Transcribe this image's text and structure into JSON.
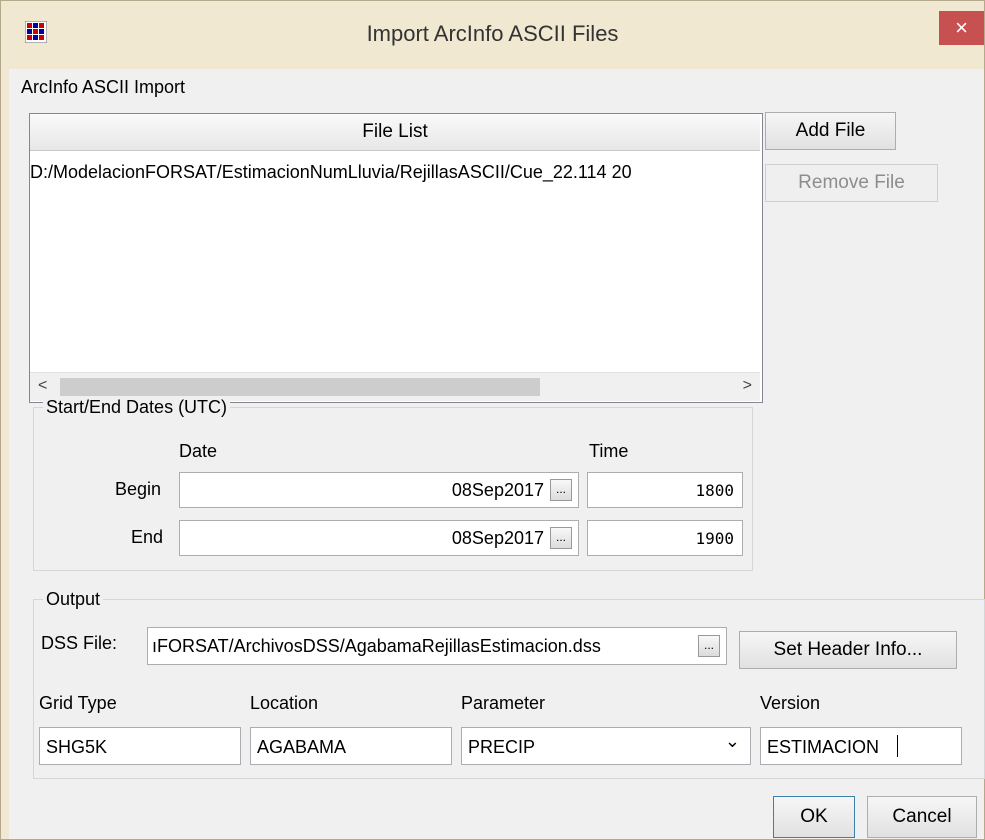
{
  "window": {
    "title": "Import ArcInfo ASCII Files",
    "close_glyph": "×",
    "app_icon": "grid-app-icon"
  },
  "import_section": {
    "label": "ArcInfo ASCII Import",
    "file_list_header": "File List",
    "files": [
      "D:/ModelacionFORSAT/EstimacionNumLluvia/RejillasASCII/Cue_22.114 20"
    ],
    "add_file": "Add File",
    "remove_file": "Remove File",
    "scroll_left": "<",
    "scroll_right": ">"
  },
  "dates": {
    "group_title": "Start/End Dates (UTC)",
    "date_header": "Date",
    "time_header": "Time",
    "begin_label": "Begin",
    "end_label": "End",
    "begin_date": "08Sep2017",
    "begin_time": "1800",
    "end_date": "08Sep2017",
    "end_time": "1900",
    "picker_glyph": "..."
  },
  "output": {
    "group_title": "Output",
    "dss_label": "DSS File:",
    "dss_value": "ıFORSAT/ArchivosDSS/AgabamaRejillasEstimacion.dss",
    "browse_glyph": "...",
    "set_header": "Set Header Info...",
    "grid_type_label": "Grid Type",
    "location_label": "Location",
    "parameter_label": "Parameter",
    "version_label": "Version",
    "grid_type": "SHG5K",
    "location": "AGABAMA",
    "parameter": "PRECIP",
    "dropdown_glyph": "⌄",
    "version": "ESTIMACION"
  },
  "buttons": {
    "ok": "OK",
    "cancel": "Cancel"
  }
}
